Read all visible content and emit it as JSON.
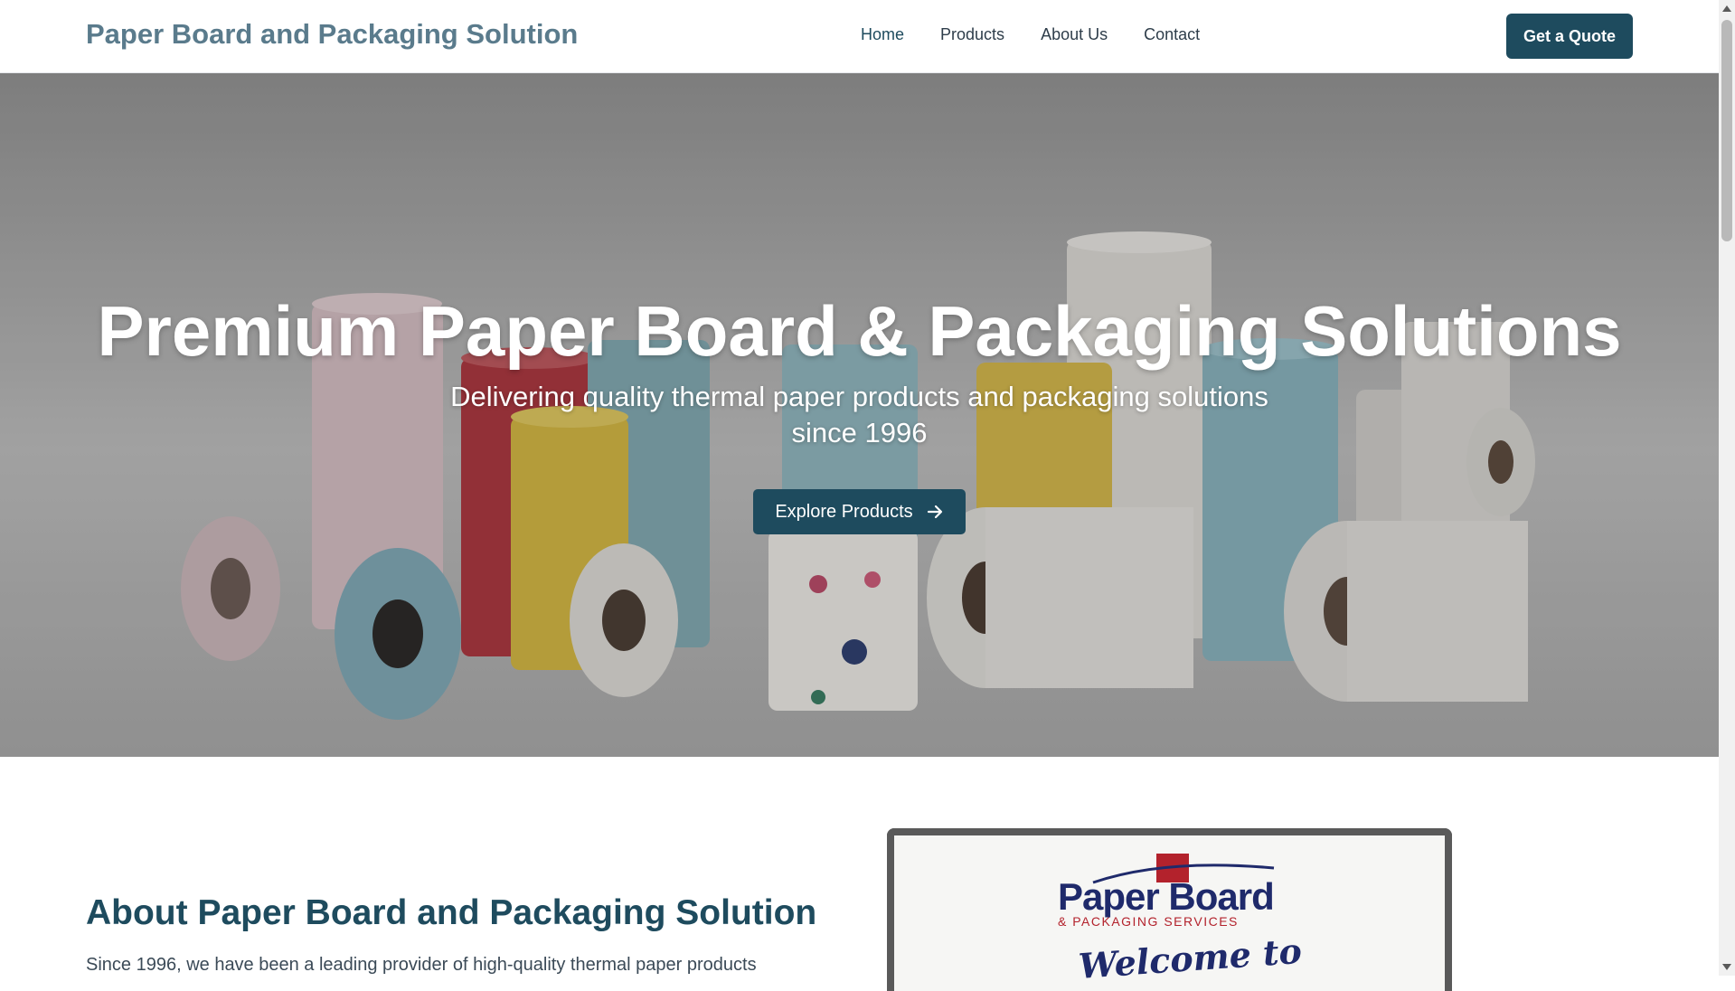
{
  "header": {
    "brand": "Paper Board and Packaging Solution",
    "nav": [
      "Home",
      "Products",
      "About Us",
      "Contact"
    ],
    "quote_button": "Get a Quote"
  },
  "hero": {
    "title": "Premium Paper Board & Packaging Solutions",
    "subtitle": "Delivering quality thermal paper products and packaging solutions since 1996",
    "button": "Explore Products",
    "image_icon": "paper-rolls-photo"
  },
  "about": {
    "title": "About Paper Board and Packaging Solution",
    "text": "Since 1996, we have been a leading provider of high-quality thermal paper products",
    "logo_text": "Paper Board",
    "logo_subtext": "& PACKAGING SERVICES",
    "welcome_text": "Welcome to"
  },
  "colors": {
    "primary": "#1e4b5e",
    "brand_text": "#5a7b8c",
    "logo_navy": "#1f2a6b",
    "logo_red": "#b3222c"
  }
}
